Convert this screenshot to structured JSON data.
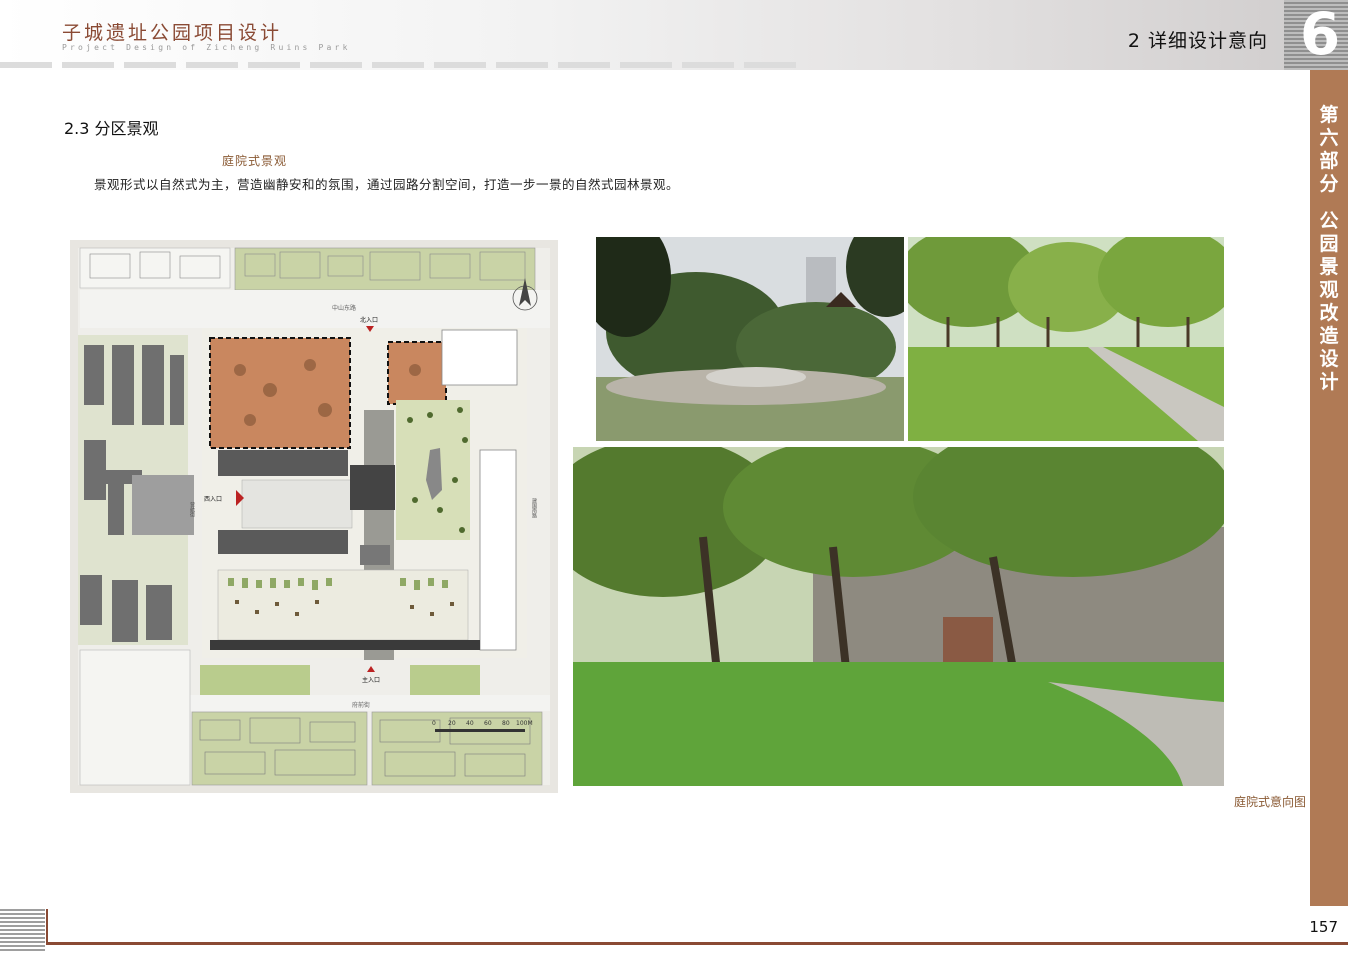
{
  "header": {
    "brand_title": "子城遗址公园项目设计",
    "brand_subtitle": "Project Design of Zicheng Ruins Park",
    "section_title": "2  详细设计意向",
    "chapter_number": "6"
  },
  "side_band": {
    "chars": [
      "第",
      "六",
      "部",
      "分",
      "",
      "公",
      "园",
      "景",
      "观",
      "改",
      "造",
      "设",
      "计"
    ]
  },
  "content": {
    "subheading": "2.3  分区景观",
    "category_label": "庭院式景观",
    "description": "景观形式以自然式为主，营造幽静安和的氛围，通过园路分割空间，打造一步一景的自然式园林景观。"
  },
  "plan": {
    "road_top": "中山东路",
    "road_bottom": "府前街",
    "road_left": "营航街",
    "road_right": "建国南路",
    "north_entrance": "北入口",
    "west_entrance": "西入口",
    "main_entrance": "主入口",
    "scale_labels": [
      "0",
      "20",
      "40",
      "60",
      "80",
      "100M"
    ]
  },
  "photos": {
    "caption": "庭院式意向图"
  },
  "footer": {
    "page_number": "157"
  },
  "colors": {
    "brand": "#8a4a34",
    "side_band": "#b07a55",
    "caption": "#8a5a34"
  }
}
